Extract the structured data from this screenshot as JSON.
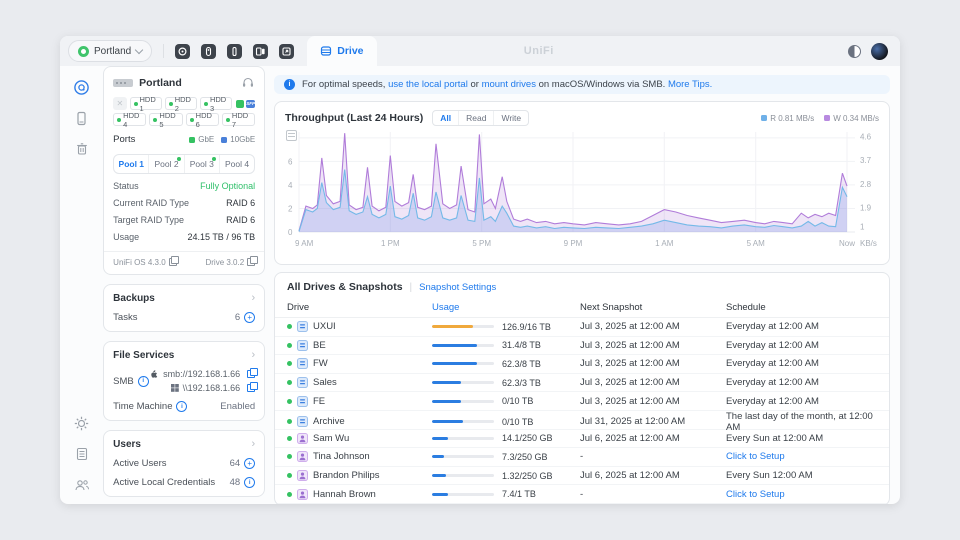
{
  "colors": {
    "accent": "#1f7aec",
    "green": "#35c262",
    "status_green": "#31c06b",
    "bar_blue": "#2b7de1",
    "bar_orange": "#f0a93c",
    "read": "#74b9e8",
    "write": "#b07cd9"
  },
  "topbar": {
    "console_name": "Portland",
    "drive_tab_label": "Drive",
    "brand": "UniFi",
    "app_icons": [
      "protect",
      "access",
      "talk",
      "display",
      "connect"
    ]
  },
  "rail": {
    "icons": [
      "drive-logo",
      "console",
      "trash",
      "settings",
      "logs",
      "users"
    ]
  },
  "device": {
    "name": "Portland",
    "hdds": [
      "HDD 1",
      "HDD 2",
      "HDD 3",
      "HDD 4",
      "HDD 5",
      "HDD 6",
      "HDD 7"
    ],
    "sfp_label": "SFP",
    "ports_label": "Ports",
    "port_legend": [
      {
        "label": "GbE",
        "color": "#35c262"
      },
      {
        "label": "10GbE",
        "color": "#4a80d9"
      }
    ],
    "pools": [
      "Pool 1",
      "Pool 2",
      "Pool 3",
      "Pool 4"
    ],
    "info_rows": [
      {
        "label": "Status",
        "value": "Fully Optional"
      },
      {
        "label": "Current RAID Type",
        "value": "RAID 6"
      },
      {
        "label": "Target RAID Type",
        "value": "RAID 6"
      },
      {
        "label": "Usage",
        "value": "24.15 TB / 96 TB"
      }
    ],
    "footer_left": "UniFi OS 4.3.0",
    "footer_right": "Drive 3.0.2"
  },
  "backups": {
    "title": "Backups",
    "tasks_label": "Tasks",
    "tasks_count": "6"
  },
  "file_services": {
    "title": "File Services",
    "smb_label": "SMB",
    "smb_mac": "smb://192.168.1.66",
    "smb_win": "\\\\192.168.1.66",
    "tm_label": "Time Machine",
    "tm_value": "Enabled"
  },
  "users": {
    "title": "Users",
    "rows": [
      {
        "label": "Active Users",
        "value": "64",
        "icon": "plus"
      },
      {
        "label": "Active Local Credentials",
        "value": "48",
        "icon": "info"
      }
    ]
  },
  "banner": {
    "prefix": "For optimal speeds, ",
    "link1": "use the local portal",
    "mid1": " or ",
    "link2": "mount drives",
    "suffix": " on macOS/Windows via SMB. ",
    "link3": "More Tips."
  },
  "chart_data": {
    "type": "area",
    "title": "Throughput (Last 24 Hours)",
    "tabs": [
      "All",
      "Read",
      "Write"
    ],
    "active_tab": "All",
    "legend": [
      {
        "label": "R 0.81 MB/s",
        "color": "#6fb0e8"
      },
      {
        "label": "W 0.34 MB/s",
        "color": "#b88ae0"
      }
    ],
    "x_ticks": [
      "9 AM",
      "1 PM",
      "5 PM",
      "9 PM",
      "1 AM",
      "5 AM",
      "Now"
    ],
    "xlim": [
      0,
      24
    ],
    "ylim": [
      0,
      8.5
    ],
    "y_left_ticks": [
      "6",
      "4",
      "2",
      "0"
    ],
    "y_right_ticks": [
      "4.6",
      "3.7",
      "2.8",
      "1.9",
      "1"
    ],
    "y_right_unit": "KB/s",
    "grid": true,
    "legend_position": "top-right",
    "x": [
      0,
      0.3,
      0.6,
      0.8,
      1.0,
      1.2,
      1.5,
      1.8,
      2.0,
      2.2,
      2.5,
      2.8,
      3.0,
      3.2,
      3.5,
      3.8,
      4.0,
      4.2,
      4.5,
      4.8,
      5.0,
      5.2,
      5.5,
      5.8,
      6.0,
      6.3,
      6.6,
      6.9,
      7.1,
      7.4,
      7.7,
      7.9,
      8.1,
      8.4,
      8.6,
      8.9,
      9.1,
      9.4,
      9.7,
      10.0,
      10.4,
      10.8,
      11.2,
      11.6,
      12.0,
      12.5,
      13.0,
      13.5,
      14.0,
      14.5,
      15.0,
      15.5,
      16.0,
      16.5,
      17.0,
      17.5,
      18.0,
      18.5,
      19.0,
      19.5,
      20.0,
      20.4,
      20.8,
      21.2,
      21.6,
      22.0,
      22.3,
      22.6,
      22.9,
      23.2,
      23.5,
      23.8,
      24.0
    ],
    "series": [
      {
        "name": "Write",
        "color": "#b07cd9",
        "fill": "rgba(176,124,217,0.20)",
        "y": [
          0.1,
          2.2,
          2.0,
          2.3,
          6.3,
          3.1,
          2.4,
          2.6,
          8.4,
          2.3,
          1.9,
          2.1,
          5.5,
          2.2,
          1.8,
          2.1,
          6.5,
          2.6,
          2.2,
          2.5,
          4.9,
          2.1,
          1.9,
          2.2,
          7.5,
          2.4,
          2.0,
          2.3,
          5.6,
          1.9,
          1.7,
          8.3,
          2.4,
          2.8,
          2.0,
          4.7,
          2.6,
          1.1,
          0.9,
          1.1,
          0.8,
          0.9,
          0.7,
          0.8,
          0.7,
          0.6,
          0.8,
          0.7,
          0.6,
          0.7,
          0.9,
          1.4,
          1.9,
          1.7,
          1.4,
          1.2,
          1.0,
          0.8,
          0.9,
          1.0,
          0.8,
          0.7,
          0.9,
          0.8,
          0.7,
          1.6,
          1.2,
          1.5,
          1.3,
          1.6,
          1.4,
          5.0,
          3.9
        ]
      },
      {
        "name": "Read",
        "color": "#74b9e8",
        "fill": "rgba(116,150,232,0.25)",
        "y": [
          0.05,
          1.9,
          1.7,
          2.0,
          4.2,
          2.5,
          1.9,
          2.1,
          5.3,
          1.8,
          1.5,
          1.7,
          3.0,
          1.5,
          1.2,
          1.5,
          3.9,
          1.3,
          1.1,
          1.4,
          3.3,
          1.2,
          1.0,
          1.3,
          3.4,
          1.2,
          1.0,
          1.2,
          3.1,
          1.0,
          0.9,
          4.6,
          1.0,
          1.3,
          0.9,
          2.2,
          1.6,
          0.5,
          0.4,
          0.5,
          0.35,
          0.45,
          0.3,
          0.4,
          0.35,
          0.3,
          0.4,
          0.35,
          0.3,
          0.4,
          0.5,
          0.7,
          1.0,
          0.8,
          0.6,
          0.5,
          0.45,
          0.35,
          0.5,
          0.6,
          0.45,
          0.4,
          0.55,
          0.45,
          0.35,
          0.5,
          0.9,
          0.5,
          0.8,
          0.5,
          0.45,
          3.8,
          3.0
        ]
      }
    ]
  },
  "table": {
    "title": "All Drives & Snapshots",
    "settings_link": "Snapshot Settings",
    "columns": [
      "Drive",
      "Usage",
      "Next Snapshot",
      "Schedule"
    ],
    "rows": [
      {
        "name": "UXUI",
        "icon": "drive",
        "usage": "126.9/16 TB",
        "pct": 66,
        "bar_color": "#f0a93c",
        "next": "Jul 3, 2025 at 12:00 AM",
        "schedule": "Everyday at 12:00 AM",
        "schedule_link": false
      },
      {
        "name": "BE",
        "icon": "drive",
        "usage": "31.4/8 TB",
        "pct": 72,
        "next": "Jul 3, 2025 at 12:00 AM",
        "schedule": "Everyday at 12:00 AM",
        "schedule_link": false
      },
      {
        "name": "FW",
        "icon": "drive",
        "usage": "62.3/8 TB",
        "pct": 72,
        "next": "Jul 3, 2025 at 12:00 AM",
        "schedule": "Everyday at 12:00 AM",
        "schedule_link": false
      },
      {
        "name": "Sales",
        "icon": "drive",
        "usage": "62.3/3 TB",
        "pct": 46,
        "next": "Jul 3, 2025 at 12:00 AM",
        "schedule": "Everyday at 12:00 AM",
        "schedule_link": false
      },
      {
        "name": "FE",
        "icon": "drive",
        "usage": "0/10 TB",
        "pct": 46,
        "next": "Jul 3, 2025 at 12:00 AM",
        "schedule": "Everyday at 12:00 AM",
        "schedule_link": false
      },
      {
        "name": "Archive",
        "icon": "drive",
        "usage": "0/10 TB",
        "pct": 50,
        "next": "Jul 31, 2025 at 12:00 AM",
        "schedule": "The last day of the month, at 12:00 AM",
        "schedule_link": false
      },
      {
        "name": "Sam Wu",
        "icon": "user",
        "usage": "14.1/250 GB",
        "pct": 25,
        "next": "Jul 6, 2025 at 12:00 AM",
        "schedule": "Every Sun at 12:00 AM",
        "schedule_link": false
      },
      {
        "name": "Tina Johnson",
        "icon": "user",
        "usage": "7.3/250 GB",
        "pct": 20,
        "next": "-",
        "schedule": "Click to Setup",
        "schedule_link": true
      },
      {
        "name": "Brandon Philips",
        "icon": "user",
        "usage": "1.32/250 GB",
        "pct": 22,
        "next": "Jul 6, 2025 at 12:00 AM",
        "schedule": "Every Sun 12:00 AM",
        "schedule_link": false
      },
      {
        "name": "Hannah Brown",
        "icon": "user",
        "usage": "7.4/1 TB",
        "pct": 25,
        "next": "-",
        "schedule": "Click to Setup",
        "schedule_link": true
      },
      {
        "name": "",
        "icon": "user",
        "partial": true
      }
    ]
  }
}
